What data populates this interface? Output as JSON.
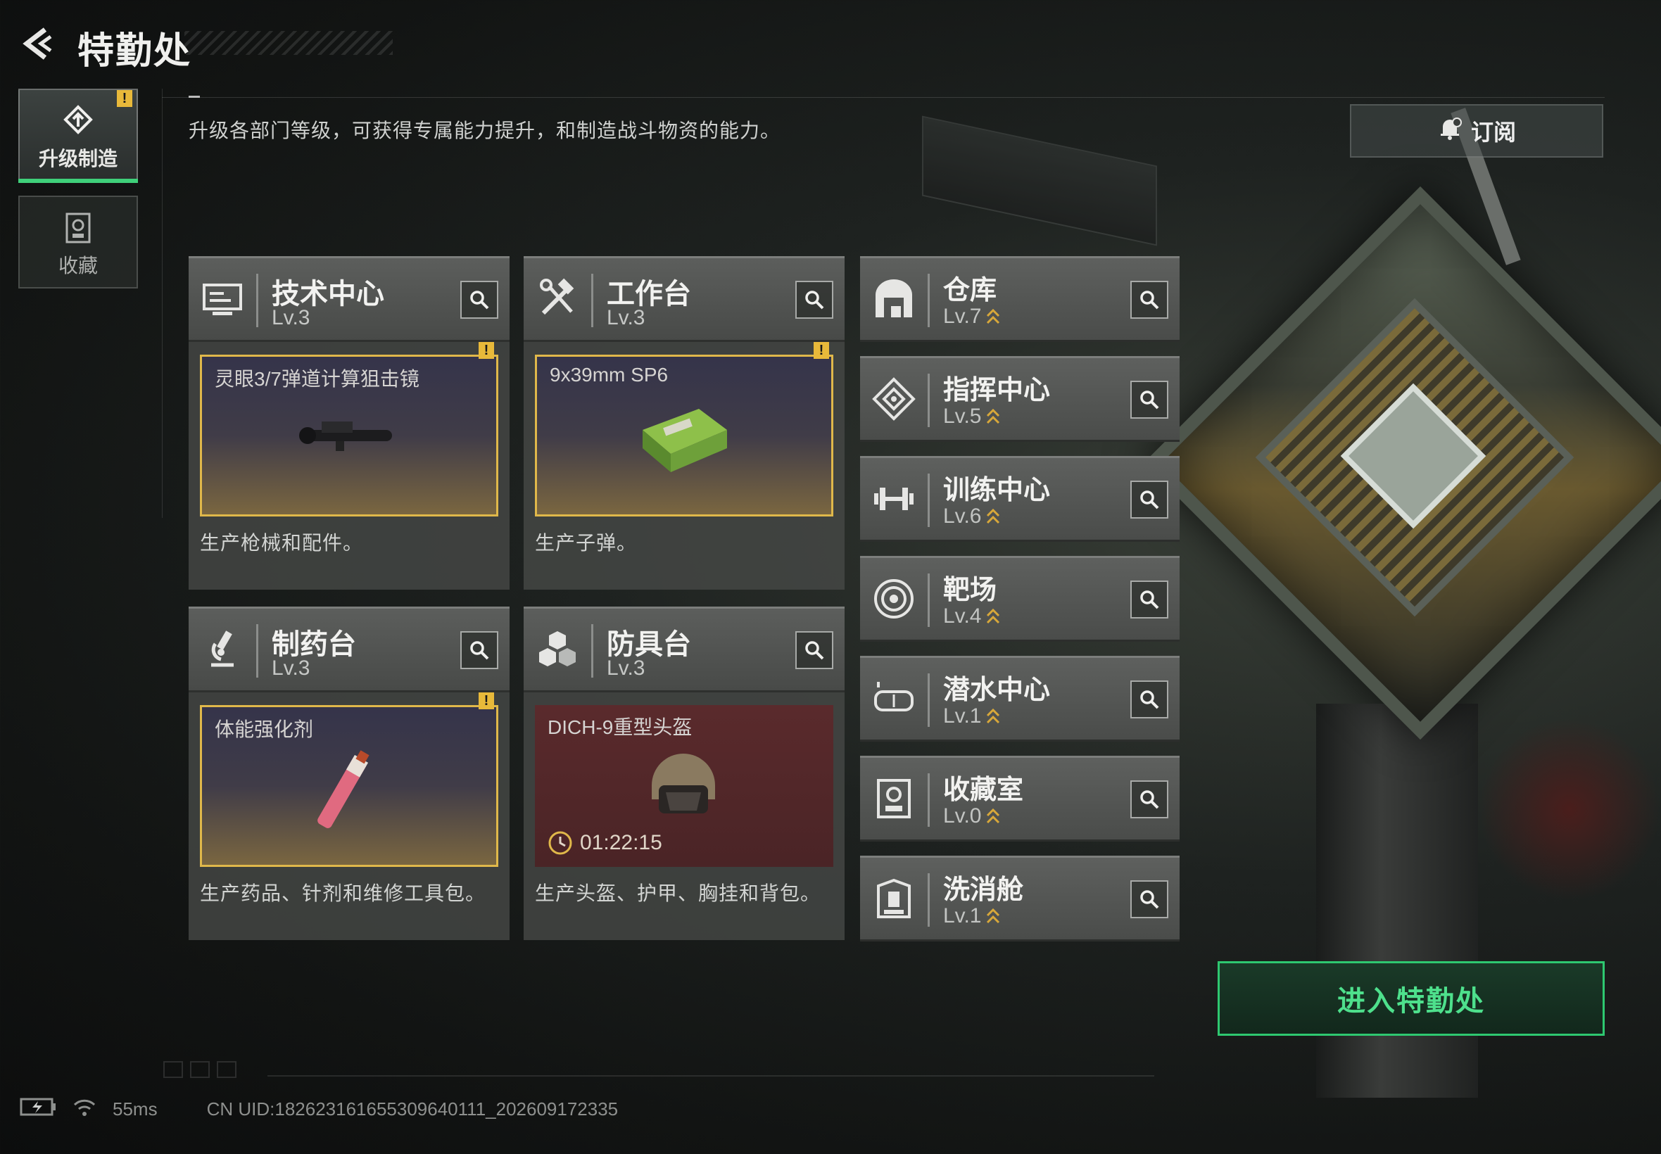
{
  "header": {
    "title": "特勤处"
  },
  "description": "升级各部门等级，可获得专属能力提升，和制造战斗物资的能力。",
  "sidebar": {
    "items": [
      {
        "label": "升级制造",
        "active": true,
        "warning": "!"
      },
      {
        "label": "收藏",
        "active": false
      }
    ]
  },
  "subscribe_label": "订阅",
  "production": [
    {
      "name": "技术中心",
      "level": "Lv.3",
      "icon": "monitor-icon",
      "item": "灵眼3/7弹道计算狙击镜",
      "warning": "!",
      "desc": "生产枪械和配件。"
    },
    {
      "name": "工作台",
      "level": "Lv.3",
      "icon": "hammer-wrench-icon",
      "item": "9x39mm SP6",
      "warning": "!",
      "desc": "生产子弹。"
    },
    {
      "name": "制药台",
      "level": "Lv.3",
      "icon": "microscope-icon",
      "item": "体能强化剂",
      "warning": "!",
      "desc": "生产药品、针剂和维修工具包。"
    },
    {
      "name": "防具台",
      "level": "Lv.3",
      "icon": "armor-blocks-icon",
      "item": "DICH-9重型头盔",
      "timer": "01:22:15",
      "desc": "生产头盔、护甲、胸挂和背包。"
    }
  ],
  "facilities": [
    {
      "name": "仓库",
      "level": "Lv.7",
      "icon": "warehouse-icon"
    },
    {
      "name": "指挥中心",
      "level": "Lv.5",
      "icon": "command-diamond-icon"
    },
    {
      "name": "训练中心",
      "level": "Lv.6",
      "icon": "dumbbell-icon"
    },
    {
      "name": "靶场",
      "level": "Lv.4",
      "icon": "target-icon"
    },
    {
      "name": "潜水中心",
      "level": "Lv.1",
      "icon": "diving-mask-icon"
    },
    {
      "name": "收藏室",
      "level": "Lv.0",
      "icon": "collection-icon"
    },
    {
      "name": "洗消舱",
      "level": "Lv.1",
      "icon": "decontamination-icon"
    }
  ],
  "enter_label": "进入特勤处",
  "status": {
    "ping": "55ms",
    "uid": "CN UID:182623161655309640111_202609172335"
  },
  "colors": {
    "accent_green": "#2ec870",
    "warning_yellow": "#e8b93a",
    "item_border": "#e0b84a"
  }
}
